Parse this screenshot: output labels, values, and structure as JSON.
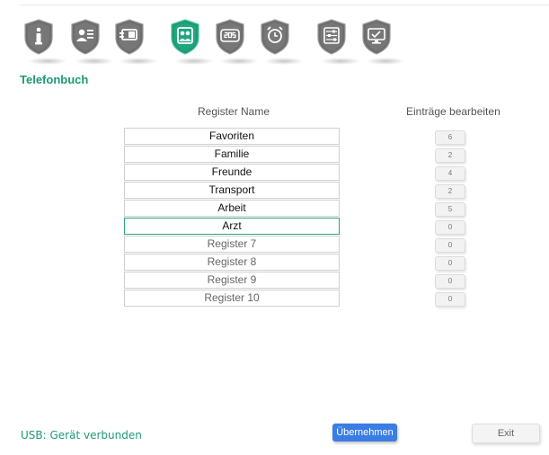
{
  "nav": {
    "icons": [
      {
        "name": "info-icon",
        "active": false
      },
      {
        "name": "user-card-icon",
        "active": false
      },
      {
        "name": "sim-card-icon",
        "active": false
      },
      {
        "name": "phonebook-icon",
        "active": true
      },
      {
        "name": "sos-icon",
        "active": false
      },
      {
        "name": "alarm-clock-icon",
        "active": false
      },
      {
        "name": "settings-sliders-icon",
        "active": false
      },
      {
        "name": "monitor-check-icon",
        "active": false
      }
    ]
  },
  "section": {
    "title": "Telefonbuch"
  },
  "table": {
    "name_header": "Register Name",
    "edit_header": "Einträge bearbeiten",
    "rows": [
      {
        "name": "Favoriten",
        "count": "6",
        "placeholder": false
      },
      {
        "name": "Familie",
        "count": "2",
        "placeholder": false
      },
      {
        "name": "Freunde",
        "count": "4",
        "placeholder": false
      },
      {
        "name": "Transport",
        "count": "2",
        "placeholder": false
      },
      {
        "name": "Arbeit",
        "count": "5",
        "placeholder": false
      },
      {
        "name": "Arzt",
        "count": "0",
        "placeholder": false,
        "selected": true
      },
      {
        "name": "Register 7",
        "count": "0",
        "placeholder": true
      },
      {
        "name": "Register 8",
        "count": "0",
        "placeholder": true
      },
      {
        "name": "Register 9",
        "count": "0",
        "placeholder": true
      },
      {
        "name": "Register 10",
        "count": "0",
        "placeholder": true
      }
    ]
  },
  "footer": {
    "status": "USB: Gerät verbunden",
    "apply_label": "Übernehmen",
    "exit_label": "Exit"
  },
  "colors": {
    "accent": "#1d9a74",
    "icon_gray": "#6d6d6d",
    "apply_blue": "#3b7de3"
  }
}
